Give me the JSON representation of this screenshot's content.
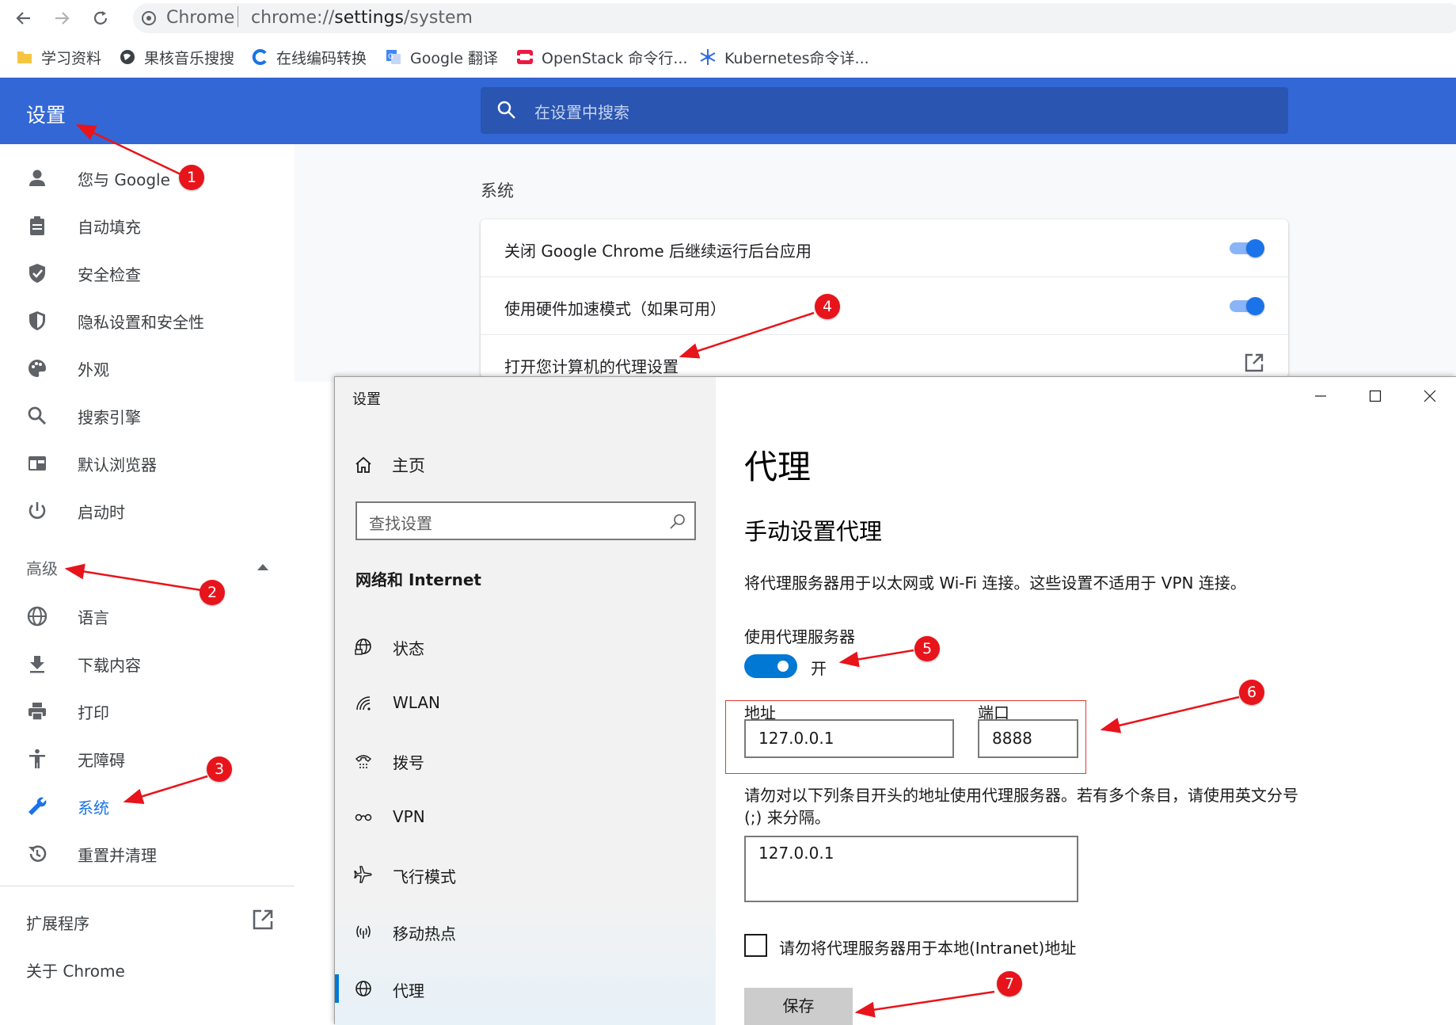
{
  "browser": {
    "site_name": "Chrome",
    "url_scheme": "chrome://",
    "url_host": "settings",
    "url_path": "/system"
  },
  "bookmarks": [
    {
      "label": "学习资料",
      "icon": "folder-icon",
      "color": "#f5c542"
    },
    {
      "label": "果核音乐搜搜",
      "icon": "globe-icon",
      "color": "#3c4043"
    },
    {
      "label": "在线编码转换",
      "icon": "encode-site-icon",
      "color": "#1a73e8"
    },
    {
      "label": "Google 翻译",
      "icon": "translate-icon",
      "color": "#4285f4"
    },
    {
      "label": "OpenStack 命令行...",
      "icon": "openstack-icon",
      "color": "#ed1944"
    },
    {
      "label": "Kubernetes命令详...",
      "icon": "snowflake-icon",
      "color": "#326ce5"
    }
  ],
  "chrome_settings": {
    "title": "设置",
    "search_placeholder": "在设置中搜索",
    "nav": [
      {
        "label": "您与 Google",
        "icon": "person-icon"
      },
      {
        "label": "自动填充",
        "icon": "clipboard-icon"
      },
      {
        "label": "安全检查",
        "icon": "shield-check-icon"
      },
      {
        "label": "隐私设置和安全性",
        "icon": "shield-icon"
      },
      {
        "label": "外观",
        "icon": "palette-icon"
      },
      {
        "label": "搜索引擎",
        "icon": "search-icon"
      },
      {
        "label": "默认浏览器",
        "icon": "browser-icon"
      },
      {
        "label": "启动时",
        "icon": "power-icon"
      }
    ],
    "advanced_label": "高级",
    "advanced_nav": [
      {
        "label": "语言",
        "icon": "globe-icon"
      },
      {
        "label": "下载内容",
        "icon": "download-icon"
      },
      {
        "label": "打印",
        "icon": "printer-icon"
      },
      {
        "label": "无障碍",
        "icon": "accessibility-icon"
      },
      {
        "label": "系统",
        "icon": "wrench-icon",
        "active": true
      },
      {
        "label": "重置并清理",
        "icon": "restore-icon"
      }
    ],
    "extensions_label": "扩展程序",
    "about_label": "关于 Chrome",
    "section_title": "系统",
    "system_rows": [
      {
        "label": "关闭 Google Chrome 后继续运行后台应用",
        "toggle": true
      },
      {
        "label": "使用硬件加速模式（如果可用）",
        "toggle": true
      },
      {
        "label": "打开您计算机的代理设置",
        "toggle": false
      }
    ]
  },
  "windows_settings": {
    "window_title": "设置",
    "home_label": "主页",
    "search_placeholder": "查找设置",
    "group_label": "网络和 Internet",
    "nav": [
      {
        "label": "状态",
        "icon": "status-globe-icon"
      },
      {
        "label": "WLAN",
        "icon": "wifi-icon"
      },
      {
        "label": "拨号",
        "icon": "dialup-icon"
      },
      {
        "label": "VPN",
        "icon": "vpn-icon"
      },
      {
        "label": "飞行模式",
        "icon": "airplane-icon"
      },
      {
        "label": "移动热点",
        "icon": "hotspot-icon"
      },
      {
        "label": "代理",
        "icon": "proxy-globe-icon",
        "active": true
      }
    ],
    "page_heading": "代理",
    "manual_heading": "手动设置代理",
    "description": "将代理服务器用于以太网或 Wi-Fi 连接。这些设置不适用于 VPN 连接。",
    "use_proxy_label": "使用代理服务器",
    "use_proxy_state": "开",
    "address_label": "地址",
    "address_value": "127.0.0.1",
    "port_label": "端口",
    "port_value": "8888",
    "exclusions_description": "请勿对以下列条目开头的地址使用代理服务器。若有多个条目，请使用英文分号 (;) 来分隔。",
    "exclusions_value": "127.0.0.1",
    "local_bypass_label": "请勿将代理服务器用于本地(Intranet)地址",
    "local_bypass_checked": false,
    "save_label": "保存"
  },
  "annotations": {
    "color": "#e8141b",
    "badges": [
      "1",
      "2",
      "3",
      "4",
      "5",
      "6",
      "7"
    ]
  },
  "colors": {
    "chrome_blue": "#3367d6",
    "chrome_accent": "#1a73e8",
    "windows_accent": "#0078d4"
  }
}
